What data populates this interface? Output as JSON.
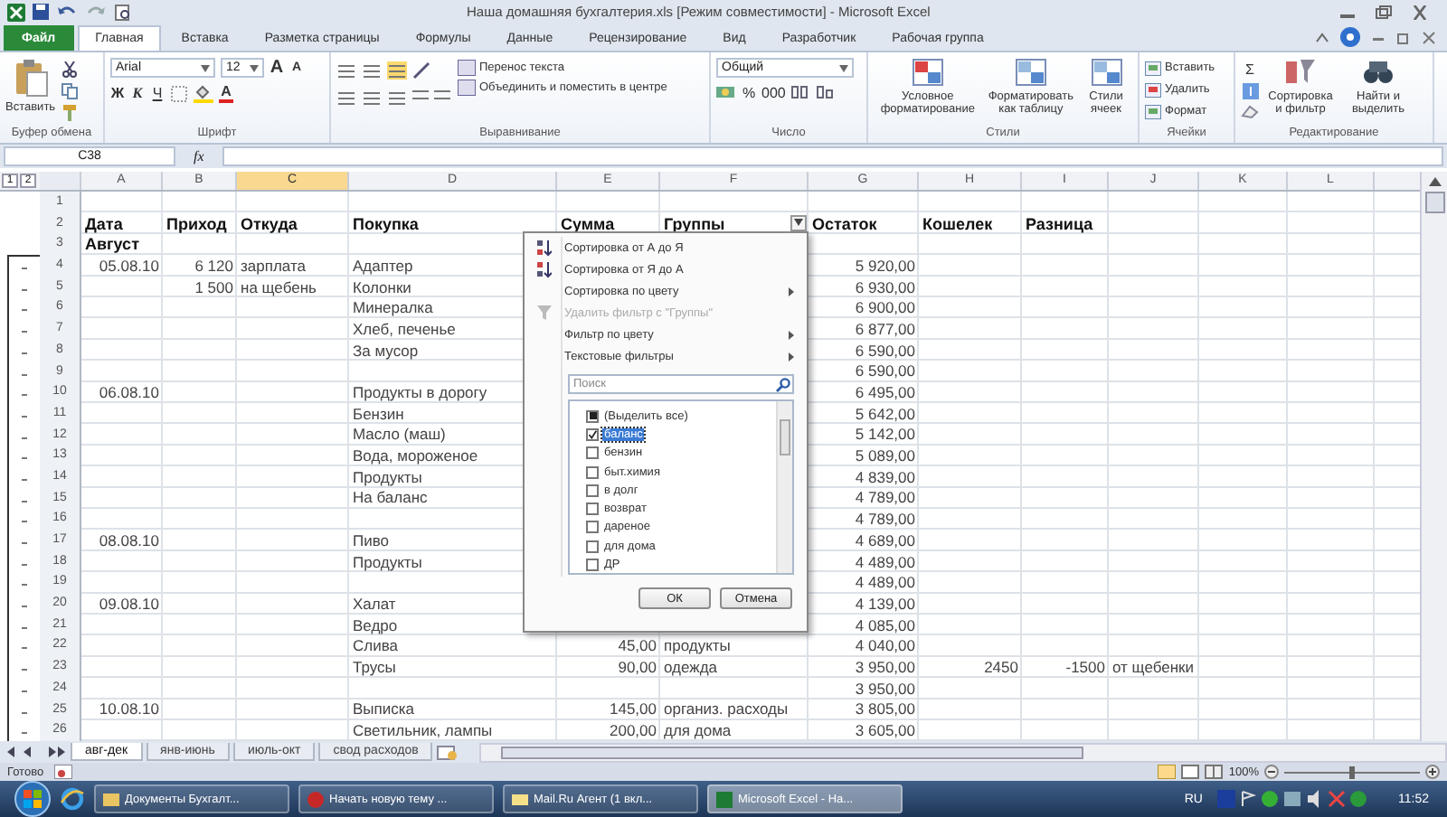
{
  "window": {
    "title": "Наша домашняя бухгалтерия.xls  [Режим совместимости]  -  Microsoft Excel"
  },
  "ribbon_tabs": [
    {
      "label": "Файл",
      "kind": "file",
      "selected": false
    },
    {
      "label": "Главная",
      "kind": "tab",
      "selected": true
    },
    {
      "label": "Вставка",
      "kind": "tab",
      "selected": false
    },
    {
      "label": "Разметка страницы",
      "kind": "tab",
      "selected": false
    },
    {
      "label": "Формулы",
      "kind": "tab",
      "selected": false
    },
    {
      "label": "Данные",
      "kind": "tab",
      "selected": false
    },
    {
      "label": "Рецензирование",
      "kind": "tab",
      "selected": false
    },
    {
      "label": "Вид",
      "kind": "tab",
      "selected": false
    },
    {
      "label": "Разработчик",
      "kind": "tab",
      "selected": false
    },
    {
      "label": "Рабочая группа",
      "kind": "tab",
      "selected": false
    }
  ],
  "ribbon": {
    "clipboard": {
      "label": "Буфер обмена",
      "paste": "Вставить"
    },
    "font": {
      "label": "Шрифт",
      "family": "Arial",
      "size": "12",
      "grow": "A",
      "shrink": "A",
      "bold": "Ж",
      "italic": "К",
      "underline": "Ч",
      "text_color_button": "A"
    },
    "alignment": {
      "label": "Выравнивание",
      "wrap": "Перенос текста",
      "merge": "Объединить и поместить в центре"
    },
    "number": {
      "label": "Число",
      "format": "Общий",
      "percent": "%",
      "thousands": "000"
    },
    "styles": {
      "label": "Стили",
      "buttons": [
        "Условное форматирование",
        "Форматировать как таблицу",
        "Стили ячеек"
      ]
    },
    "cells": {
      "label": "Ячейки",
      "buttons": [
        "Вставить",
        "Удалить",
        "Формат"
      ]
    },
    "editing": {
      "label": "Редактирование",
      "sum": "Σ",
      "buttons": [
        "Сортировка и фильтр",
        "Найти и выделить"
      ]
    }
  },
  "formula_bar": {
    "name_box": "C38",
    "fx": "fx"
  },
  "outline_levels": [
    "1",
    "2"
  ],
  "columns": [
    {
      "letter": "A",
      "selected": false,
      "filter": false
    },
    {
      "letter": "B",
      "selected": false,
      "filter": false
    },
    {
      "letter": "C",
      "selected": true,
      "filter": false
    },
    {
      "letter": "D",
      "selected": false,
      "filter": false
    },
    {
      "letter": "E",
      "selected": false,
      "filter": false
    },
    {
      "letter": "F",
      "selected": false,
      "filter": true
    },
    {
      "letter": "G",
      "selected": false,
      "filter": false
    },
    {
      "letter": "H",
      "selected": false,
      "filter": false
    },
    {
      "letter": "I",
      "selected": false,
      "filter": false
    },
    {
      "letter": "J",
      "selected": false,
      "filter": false
    },
    {
      "letter": "K",
      "selected": false,
      "filter": false
    },
    {
      "letter": "L",
      "selected": false,
      "filter": false
    }
  ],
  "rows": [
    {
      "num": "1",
      "kind": "blank"
    },
    {
      "num": "2",
      "kind": "header",
      "date": "Дата",
      "income": "Приход",
      "source": "Откуда",
      "purchase": "Покупка",
      "sum": "Сумма",
      "group": "Группы",
      "balance": "Остаток",
      "wallet": "Кошелек",
      "diff": "Разница"
    },
    {
      "num": "3",
      "kind": "section",
      "date": "Август"
    },
    {
      "kind": "group",
      "children": [
        {
          "num": "4",
          "kind": "data",
          "date": "05.08.10",
          "income": "6 120",
          "source": "зарплата",
          "purchase": "Адаптер",
          "balance": "5 920,00"
        },
        {
          "num": "5",
          "kind": "data",
          "income": "1 500",
          "source": "на щебень",
          "purchase": "Колонки",
          "balance": "6 930,00"
        },
        {
          "num": "6",
          "kind": "data",
          "purchase": "Минералка",
          "balance": "6 900,00"
        },
        {
          "num": "7",
          "kind": "data",
          "purchase": "Хлеб, печенье",
          "balance": "6 877,00"
        },
        {
          "num": "8",
          "kind": "data",
          "purchase": "За мусор",
          "balance": "6 590,00"
        },
        {
          "num": "9",
          "kind": "data",
          "balance": "6 590,00"
        },
        {
          "num": "10",
          "kind": "data",
          "date": "06.08.10",
          "purchase": "Продукты в дорогу",
          "balance": "6 495,00"
        },
        {
          "num": "11",
          "kind": "data",
          "purchase": "Бензин",
          "balance": "5 642,00"
        },
        {
          "num": "12",
          "kind": "data",
          "purchase": "Масло (маш)",
          "balance": "5 142,00"
        },
        {
          "num": "13",
          "kind": "data",
          "purchase": "Вода, мороженое",
          "balance": "5 089,00"
        },
        {
          "num": "14",
          "kind": "data",
          "purchase": "Продукты",
          "balance": "4 839,00"
        },
        {
          "num": "15",
          "kind": "data",
          "purchase": "На баланс",
          "balance": "4 789,00"
        },
        {
          "num": "16",
          "kind": "data",
          "balance": "4 789,00"
        },
        {
          "num": "17",
          "kind": "data",
          "date": "08.08.10",
          "purchase": "Пиво",
          "balance": "4 689,00"
        },
        {
          "num": "18",
          "kind": "data",
          "purchase": "Продукты",
          "balance": "4 489,00"
        },
        {
          "num": "19",
          "kind": "data",
          "balance": "4 489,00"
        },
        {
          "num": "20",
          "kind": "data",
          "date": "09.08.10",
          "purchase": "Халат",
          "balance": "4 139,00"
        },
        {
          "num": "21",
          "kind": "data",
          "purchase": "Ведро",
          "balance": "4 085,00"
        },
        {
          "num": "22",
          "kind": "data",
          "purchase": "Слива",
          "sum": "45,00",
          "group": "продукты",
          "balance": "4 040,00"
        },
        {
          "num": "23",
          "kind": "data",
          "purchase": "Трусы",
          "sum": "90,00",
          "group": "одежда",
          "balance": "3 950,00",
          "wallet": "2450",
          "diff": "-1500",
          "note": "от щебенки"
        },
        {
          "num": "24",
          "kind": "data",
          "balance": "3 950,00"
        },
        {
          "num": "25",
          "kind": "data",
          "date": "10.08.10",
          "purchase": "Выписка",
          "sum": "145,00",
          "group": "организ. расходы",
          "balance": "3 805,00"
        },
        {
          "num": "26",
          "kind": "data",
          "purchase": "Светильник, лампы",
          "sum": "200,00",
          "group": "для дома",
          "balance": "3 605,00"
        }
      ]
    }
  ],
  "filter_menu": {
    "items": [
      {
        "label": "Сортировка от А до Я",
        "kind": "sort-asc",
        "submenu": false,
        "disabled": false
      },
      {
        "label": "Сортировка от Я до А",
        "kind": "sort-desc",
        "submenu": false,
        "disabled": false
      },
      {
        "label": "Сортировка по цвету",
        "kind": "plain",
        "submenu": true,
        "disabled": false
      },
      {
        "label": "Удалить фильтр с \"Группы\"",
        "kind": "clear",
        "submenu": false,
        "disabled": true
      },
      {
        "label": "Фильтр по цвету",
        "kind": "plain",
        "submenu": true,
        "disabled": false
      },
      {
        "label": "Текстовые фильтры",
        "kind": "plain",
        "submenu": true,
        "disabled": false
      }
    ],
    "search": {
      "placeholder": "Поиск"
    },
    "values": [
      {
        "label": "(Выделить все)",
        "kind": "select-all",
        "partial": true,
        "selected": false
      },
      {
        "label": "баланс",
        "kind": "value",
        "checked": true,
        "selected": true
      },
      {
        "label": "бензин",
        "kind": "value",
        "checked": false,
        "selected": false
      },
      {
        "label": "быт.химия",
        "kind": "value",
        "checked": false,
        "selected": false
      },
      {
        "label": "в долг",
        "kind": "value",
        "checked": false,
        "selected": false
      },
      {
        "label": "возврат",
        "kind": "value",
        "checked": false,
        "selected": false
      },
      {
        "label": "дареное",
        "kind": "value",
        "checked": false,
        "selected": false
      },
      {
        "label": "для дома",
        "kind": "value",
        "checked": false,
        "selected": false
      },
      {
        "label": "ДР",
        "kind": "value",
        "checked": false,
        "selected": false
      }
    ],
    "ok": "ОК",
    "cancel": "Отмена"
  },
  "sheet_tabs": [
    {
      "label": "авг-дек",
      "selected": true
    },
    {
      "label": "янв-июнь",
      "selected": false
    },
    {
      "label": "июль-окт",
      "selected": false
    },
    {
      "label": "свод расходов",
      "selected": false
    }
  ],
  "status_bar": {
    "ready": "Готово",
    "zoom": "100%",
    "zoom_slider": {
      "level": 0.5
    }
  },
  "taskbar": {
    "tasks": [
      {
        "label": "Документы Бухгалт...",
        "kind": "folder",
        "selected": false
      },
      {
        "label": "Начать новую тему ...",
        "kind": "browser",
        "selected": false
      },
      {
        "label": "Mail.Ru Агент (1 вкл...",
        "kind": "mail",
        "selected": false
      },
      {
        "label": "Microsoft Excel - На...",
        "kind": "excel",
        "selected": true
      }
    ],
    "language": "RU",
    "clock": "11:52"
  }
}
